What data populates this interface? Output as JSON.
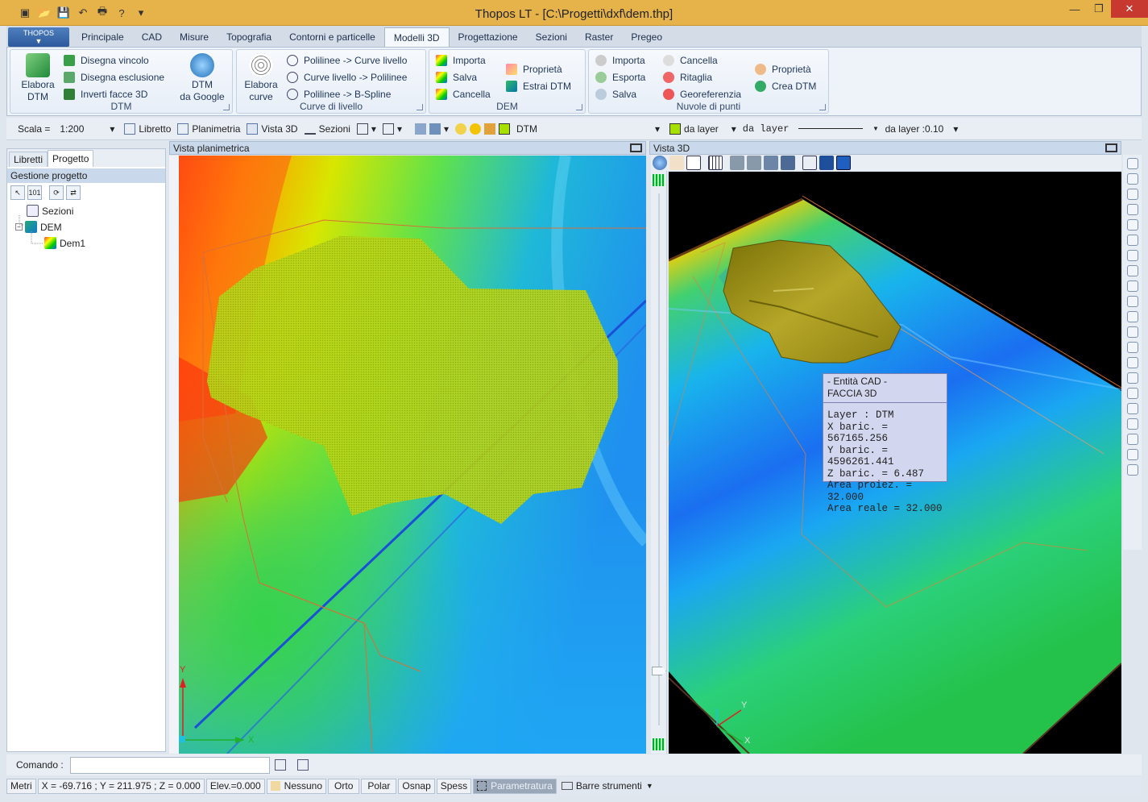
{
  "app": {
    "title": "Thopos LT - [C:\\Progetti\\dxf\\dem.thp]",
    "menu_label": "THOPOS"
  },
  "ribbon": {
    "tabs": [
      "Principale",
      "CAD",
      "Misure",
      "Topografia",
      "Contorni e particelle",
      "Modelli 3D",
      "Progettazione",
      "Sezioni",
      "Raster",
      "Pregeo"
    ],
    "active_tab": "Modelli 3D",
    "groups": {
      "dtm": {
        "label": "DTM",
        "elabora": "Elabora\nDTM",
        "disegna_vincolo": "Disegna vincolo",
        "disegna_esclusione": "Disegna esclusione",
        "inverti_facce": "Inverti facce 3D",
        "dtm_google": "DTM\nda Google"
      },
      "curve": {
        "label": "Curve di livello",
        "elabora": "Elabora\ncurve",
        "poly_curve": "Polilinee -> Curve livello",
        "curve_poly": "Curve livello -> Polilinee",
        "poly_bspline": "Polilinee -> B-Spline"
      },
      "dem": {
        "label": "DEM",
        "importa": "Importa",
        "salva": "Salva",
        "cancella": "Cancella",
        "proprieta": "Proprietà",
        "estrai": "Estrai DTM"
      },
      "nuvole": {
        "label": "Nuvole di punti",
        "importa": "Importa",
        "esporta": "Esporta",
        "salva": "Salva",
        "cancella": "Cancella",
        "ritaglia": "Ritaglia",
        "georef": "Georeferenzia",
        "proprieta": "Proprietà",
        "crea": "Crea DTM"
      }
    }
  },
  "options": {
    "scala_label": "Scala =",
    "scala_value": "1:200",
    "libretto": "Libretto",
    "planimetria": "Planimetria",
    "vista3d": "Vista 3D",
    "sezioni": "Sezioni",
    "layer": "DTM",
    "color": "da layer",
    "linetype": "da layer",
    "lineweight": "da layer :0.10",
    "layer_color": "#a8e000"
  },
  "left_panel": {
    "tabs": [
      "Libretti",
      "Progetto"
    ],
    "active_tab": "Progetto",
    "header": "Gestione progetto",
    "tree": [
      "Sezioni",
      "DEM",
      "Dem1"
    ]
  },
  "views": {
    "plan_title": "Vista planimetrica",
    "view3d_title": "Vista 3D",
    "axis_y": "Y",
    "axis_x": "X"
  },
  "tooltip": {
    "line1": "- Entità CAD -",
    "line2": "FACCIA 3D",
    "layer": "Layer : DTM",
    "x": "X baric. = 567165.256",
    "y": "Y baric. = 4596261.441",
    "z": "Z baric. = 6.487",
    "area_proj": "Area proiez. = 32.000",
    "area_real": "Area reale = 32.000"
  },
  "command": {
    "label": "Comando :",
    "value": ""
  },
  "status": {
    "units": "Metri",
    "coords": "X = -69.716 ; Y = 211.975 ; Z = 0.000",
    "elev": "Elev.=0.000",
    "snap_mode": "Nessuno",
    "orto": "Orto",
    "polar": "Polar",
    "osnap": "Osnap",
    "spess": "Spess",
    "param": "Parametratura",
    "barre": "Barre strumenti"
  }
}
